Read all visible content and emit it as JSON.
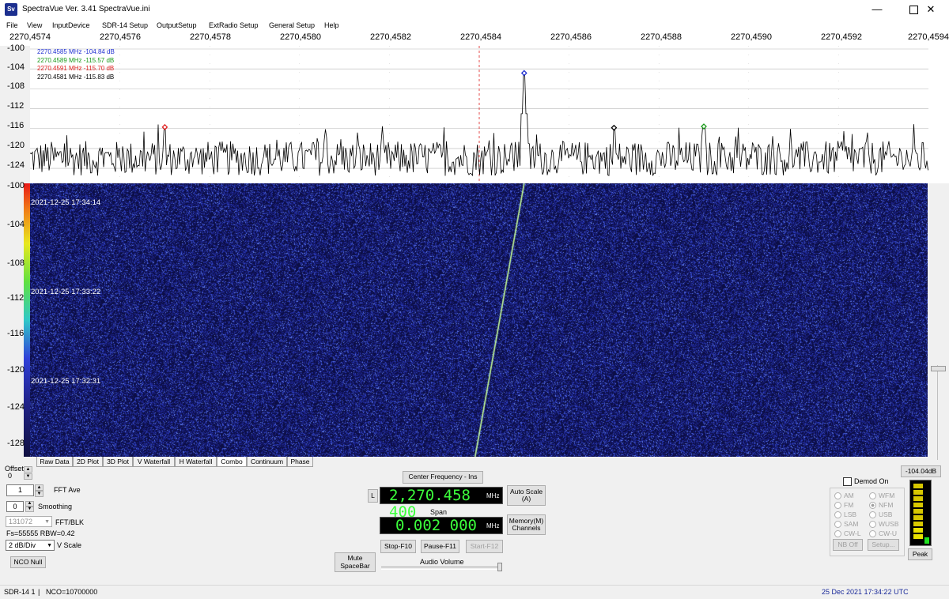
{
  "window": {
    "title": "SpectraVue Ver. 3.41  SpectraVue.ini",
    "icon_text": "Sv",
    "minimize_icon": "minimize-icon",
    "maximize_icon": "maximize-icon",
    "close_icon": "close-icon"
  },
  "menu": [
    "File",
    "View",
    "InputDevice",
    "SDR-14 Setup",
    "OutputSetup",
    "ExtRadio Setup",
    "General Setup",
    "Help"
  ],
  "freq_axis": {
    "ticks": [
      "2270,4574",
      "2270,4576",
      "2270,4578",
      "2270,4580",
      "2270,4582",
      "2270,4584",
      "2270,4586",
      "2270,4588",
      "2270,4590",
      "2270,4592",
      "2270,4594"
    ],
    "min": 2270.4574,
    "max": 2270.4594
  },
  "spectrum": {
    "y_labels": [
      "-100",
      "-104",
      "-108",
      "-112",
      "-116",
      "-120",
      "-124"
    ],
    "ylim": [
      -100,
      -127
    ],
    "markers": [
      {
        "label": "2270.4585 MHz  -104.84 dB",
        "color": "#1f2fd0",
        "freq": 2270.4585,
        "db": -104.84
      },
      {
        "label": "2270.4589 MHz  -115.57 dB",
        "color": "#1a9a1a",
        "freq": 2270.4589,
        "db": -115.57
      },
      {
        "label": "2270.4591 MHz  -115.70 dB",
        "color": "#e02020",
        "freq": 2270.4577,
        "db": -115.7
      },
      {
        "label": "2270.4581 MHz  -115.83 dB",
        "color": "#000000",
        "freq": 2270.4587,
        "db": -115.83
      }
    ],
    "center_freq": 2270.4584,
    "noise_floor_db": -122
  },
  "waterfall": {
    "y_labels": [
      "-100",
      "-104",
      "-108",
      "-112",
      "-116",
      "-120",
      "-124",
      "-128"
    ],
    "timestamps": [
      "2021-12-25 17:34:14",
      "2021-12-25 17:33:22",
      "2021-12-25 17:32:31"
    ],
    "background_color": "#1b237a",
    "trace_color": "#c8ff9a"
  },
  "tabs": [
    {
      "label": "Raw Data",
      "active": false
    },
    {
      "label": "2D Plot",
      "active": false
    },
    {
      "label": "3D Plot",
      "active": false
    },
    {
      "label": "V Waterfall",
      "active": false
    },
    {
      "label": "H Waterfall",
      "active": false
    },
    {
      "label": "Combo",
      "active": true
    },
    {
      "label": "Continuum",
      "active": false
    },
    {
      "label": "Phase",
      "active": false
    }
  ],
  "controls": {
    "offset_label": "Offset",
    "offset_value": "0",
    "fft_ave_value": "1",
    "fft_ave_label": "FFT Ave",
    "smoothing_value": "0",
    "smoothing_label": "Smoothing",
    "fft_blk_value": "131072",
    "fft_blk_label": "FFT/BLK",
    "fs_text": "Fs=55555 RBW=0.42",
    "vscale_value": "2 dB/Div",
    "vscale_label": "V Scale",
    "nco_null": "NCO Null"
  },
  "center": {
    "center_freq_button": "Center Frequency - Ins",
    "l_button": "L",
    "center_freq_value": "2,270.458 400",
    "unit": "MHz",
    "span_label": "Span",
    "span_value": "0.002 000",
    "auto_scale_line1": "Auto Scale",
    "auto_scale_line2": "(A)",
    "memory_line1": "Memory(M)",
    "memory_line2": "Channels",
    "mute_line1": "Mute",
    "mute_line2": "SpaceBar",
    "stop": "Stop-F10",
    "pause": "Pause-F11",
    "start": "Start-F12",
    "audio_volume": "Audio Volume"
  },
  "demod": {
    "label": "Demod On",
    "modes_left": [
      "AM",
      "FM",
      "LSB",
      "SAM",
      "CW-L"
    ],
    "modes_right": [
      "WFM",
      "NFM",
      "USB",
      "WUSB",
      "CW-U"
    ],
    "selected": "NFM",
    "nb_off": "NB Off",
    "setup": "Setup..."
  },
  "meter": {
    "value": "-104.04dB",
    "peak": "Peak",
    "level": 0.05
  },
  "status": {
    "device": "SDR-14 1",
    "nco": "NCO=10700000",
    "datetime": "25 Dec 2021  17:34:22 UTC"
  }
}
